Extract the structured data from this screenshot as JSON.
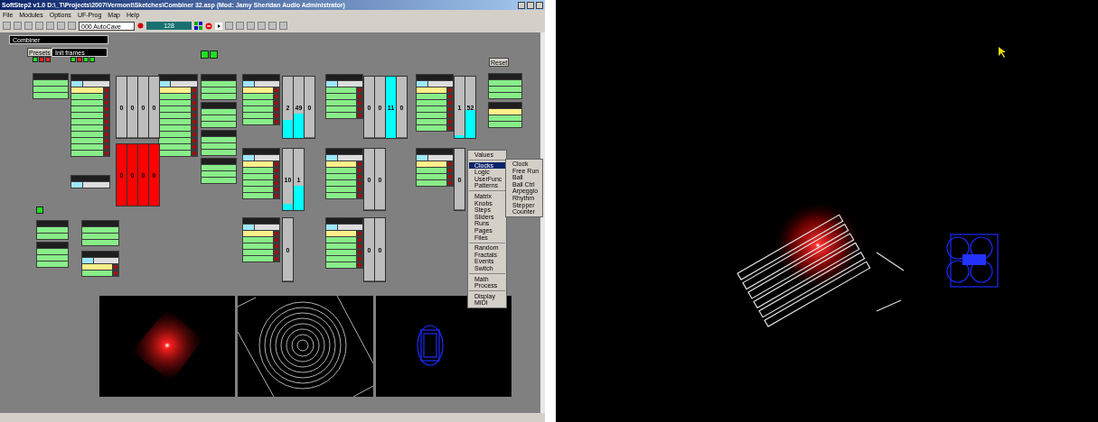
{
  "window": {
    "title": "SoftStep2 v1.0  D:\\_T\\Projects\\2007\\Vermont\\Sketches\\Combiner 32.asp  (Mod: Jamy Sheridan Audio Administrator)"
  },
  "menu": [
    "File",
    "Modules",
    "Options",
    "UF-Prog",
    "Map",
    "Help"
  ],
  "toolbar": {
    "preset_combo": "000 AutoCave",
    "slider": {
      "value": "128",
      "level": 1
    }
  },
  "canvas": {
    "name_field": "Combiner",
    "presets_button": "Presets",
    "preset_field": "Init frames",
    "reset_button": "Reset",
    "led_groups": [
      {
        "leds": [
          {
            "on": true
          },
          {
            "on": false
          },
          {
            "on": false
          }
        ]
      },
      {
        "leds": [
          {
            "on": true
          },
          {
            "on": false
          },
          {
            "on": true
          },
          {
            "on": true
          }
        ]
      },
      {
        "leds": [
          {
            "on": true
          },
          {
            "on": true
          }
        ]
      },
      {
        "leds": [
          {
            "on": true
          }
        ]
      }
    ],
    "modules": [
      {
        "kind": "input",
        "rows": [
          {
            "active": false
          },
          {
            "active": false
          },
          {
            "active": false
          }
        ]
      },
      {
        "kind": "output",
        "rows": [
          {
            "active": true
          },
          {
            "active": false
          },
          {
            "active": false
          },
          {
            "active": false
          },
          {
            "active": false
          },
          {
            "active": false
          },
          {
            "active": false
          },
          {
            "active": false
          },
          {
            "active": false
          },
          {
            "active": false
          },
          {
            "active": false
          }
        ]
      },
      {
        "kind": "output"
      },
      {
        "kind": "output",
        "rows": [
          {
            "active": true
          },
          {
            "active": false
          },
          {
            "active": false
          },
          {
            "active": false
          },
          {
            "active": false
          },
          {
            "active": false
          },
          {
            "active": false
          },
          {
            "active": false
          },
          {
            "active": false
          },
          {
            "active": false
          },
          {
            "active": false
          }
        ]
      },
      {
        "kind": "input",
        "rows": [
          {
            "active": false
          },
          {
            "active": false
          },
          {
            "active": false
          }
        ]
      },
      {
        "kind": "input",
        "rows": [
          {
            "active": false
          },
          {
            "active": false
          },
          {
            "active": false
          }
        ]
      },
      {
        "kind": "input",
        "rows": [
          {
            "active": false
          },
          {
            "active": false
          },
          {
            "active": false
          }
        ]
      },
      {
        "kind": "input",
        "rows": [
          {
            "active": false
          },
          {
            "active": false
          },
          {
            "active": false
          }
        ]
      },
      {
        "kind": "output",
        "rows": [
          {
            "active": true
          },
          {
            "active": false
          },
          {
            "active": false
          },
          {
            "active": false
          },
          {
            "active": false
          },
          {
            "active": false
          }
        ]
      },
      {
        "kind": "output",
        "rows": [
          {
            "active": false
          },
          {
            "active": false
          },
          {
            "active": false
          },
          {
            "active": false
          },
          {
            "active": false
          }
        ]
      },
      {
        "kind": "output",
        "rows": [
          {
            "active": true
          },
          {
            "active": false
          },
          {
            "active": false
          },
          {
            "active": false
          },
          {
            "active": false
          },
          {
            "active": false
          },
          {
            "active": false
          }
        ]
      },
      {
        "kind": "input",
        "rows": [
          {
            "active": false
          },
          {
            "active": false
          },
          {
            "active": false
          }
        ]
      },
      {
        "kind": "input",
        "rows": [
          {
            "active": true
          },
          {
            "active": false
          },
          {
            "active": false
          }
        ]
      },
      {
        "kind": "output",
        "rows": [
          {
            "active": true
          },
          {
            "active": false
          },
          {
            "active": false
          },
          {
            "active": false
          },
          {
            "active": false
          },
          {
            "active": false
          }
        ]
      },
      {
        "kind": "output",
        "rows": [
          {
            "active": true
          },
          {
            "active": false
          },
          {
            "active": false
          },
          {
            "active": false
          },
          {
            "active": false
          },
          {
            "active": false
          }
        ]
      },
      {
        "kind": "output",
        "rows": [
          {
            "active": true
          },
          {
            "active": false
          },
          {
            "active": false
          },
          {
            "active": false
          }
        ]
      },
      {
        "kind": "output",
        "rows": [
          {
            "active": true
          },
          {
            "active": false
          },
          {
            "active": false
          },
          {
            "active": false
          },
          {
            "active": false
          }
        ]
      },
      {
        "kind": "output",
        "rows": [
          {
            "active": true
          },
          {
            "active": false
          },
          {
            "active": false
          },
          {
            "active": false
          },
          {
            "active": false
          },
          {
            "active": false
          }
        ]
      },
      {
        "kind": "input",
        "rows": [
          {
            "active": false
          },
          {
            "active": false
          }
        ]
      },
      {
        "kind": "input",
        "rows": [
          {
            "active": false
          },
          {
            "active": false
          },
          {
            "active": false
          }
        ]
      },
      {
        "kind": "input",
        "rows": [
          {
            "active": false
          },
          {
            "active": false
          },
          {
            "active": false
          }
        ]
      },
      {
        "kind": "output",
        "rows": [
          {
            "active": true
          },
          {
            "active": false
          }
        ]
      }
    ],
    "fader_banks": [
      {
        "columns": [
          {
            "value": "0",
            "level": 0
          },
          {
            "value": "0",
            "level": 0
          },
          {
            "value": "0",
            "level": 0
          },
          {
            "value": "0",
            "level": 0
          }
        ]
      },
      {
        "color": "#ff0000",
        "columns": [
          {
            "value": "0",
            "level": 1
          },
          {
            "value": "0",
            "level": 1
          },
          {
            "value": "0",
            "level": 1
          },
          {
            "value": "0",
            "level": 1
          }
        ]
      },
      {
        "color": "#00ffff",
        "columns": [
          {
            "value": "2",
            "level": 0.3
          },
          {
            "value": "49",
            "level": 0.4
          },
          {
            "value": "0",
            "level": 0
          }
        ]
      },
      {
        "color": "#00ffff",
        "columns": [
          {
            "value": "0",
            "level": 0
          },
          {
            "value": "0",
            "level": 0
          },
          {
            "value": "11",
            "level": 1
          },
          {
            "value": "0",
            "level": 0
          }
        ]
      },
      {
        "color": "#00ffff",
        "columns": [
          {
            "value": "1",
            "level": 0.05
          },
          {
            "value": "52",
            "level": 0.45
          }
        ]
      },
      {
        "color": "#00ffff",
        "columns": [
          {
            "value": "10",
            "level": 0.1
          },
          {
            "value": "1",
            "level": 0.4
          }
        ]
      },
      {
        "columns": [
          {
            "value": "0",
            "level": 0
          },
          {
            "value": "0",
            "level": 0
          }
        ]
      },
      {
        "columns": [
          {
            "value": "0",
            "level": 0
          }
        ]
      },
      {
        "columns": [
          {
            "value": "0",
            "level": 0
          }
        ]
      },
      {
        "columns": [
          {
            "value": "0",
            "level": 0
          },
          {
            "value": "0",
            "level": 0
          }
        ]
      }
    ],
    "context_menu": {
      "groups": [
        [
          {
            "label": "Values",
            "selected": false
          }
        ],
        [
          {
            "label": "Clocks",
            "selected": true
          },
          {
            "label": "Logic",
            "selected": false
          },
          {
            "label": "UserFunc",
            "selected": false
          },
          {
            "label": "Patterns",
            "selected": false
          }
        ],
        [
          {
            "label": "Matrix",
            "selected": false
          },
          {
            "label": "Knobs",
            "selected": false
          },
          {
            "label": "Steps",
            "selected": false
          },
          {
            "label": "Sliders",
            "selected": false
          },
          {
            "label": "Runs",
            "selected": false
          },
          {
            "label": "Pages",
            "selected": false
          },
          {
            "label": "Files",
            "selected": false
          }
        ],
        [
          {
            "label": "Random",
            "selected": false
          },
          {
            "label": "Fractals",
            "selected": false
          },
          {
            "label": "Events",
            "selected": false
          },
          {
            "label": "Switch",
            "selected": false
          }
        ],
        [
          {
            "label": "Math",
            "selected": false
          },
          {
            "label": "Process",
            "selected": false
          }
        ],
        [
          {
            "label": "Display",
            "selected": false
          },
          {
            "label": "MIDI",
            "selected": false
          }
        ]
      ],
      "submenu": [
        "Clock",
        "Free Run",
        "Ball",
        "Ball Ctrl",
        "Arpeggio",
        "Rhythm",
        "Stepper",
        "Counter"
      ]
    }
  },
  "previews": [
    {
      "kind": "glow"
    },
    {
      "kind": "rings"
    },
    {
      "kind": "shape"
    }
  ]
}
